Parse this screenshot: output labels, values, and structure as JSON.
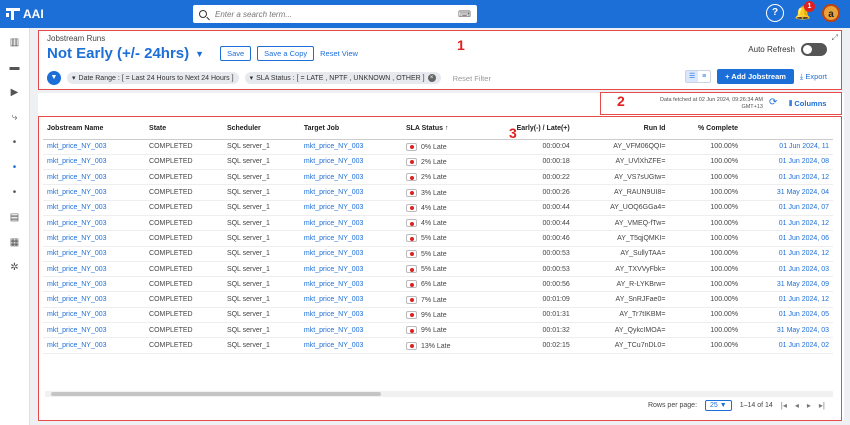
{
  "app": {
    "logo_text": "AAI"
  },
  "search": {
    "placeholder": "Enter a search term...",
    "shortcut_icon": "keyboard-icon"
  },
  "topbar": {
    "help_label": "?",
    "notification_count": "1",
    "avatar_initial": "a"
  },
  "sidebar": {
    "items": [
      {
        "icon": "dashboard-icon",
        "glyph": "▥"
      },
      {
        "icon": "divider-icon",
        "glyph": "▬"
      },
      {
        "icon": "play-icon",
        "glyph": "▶"
      },
      {
        "icon": "workflow-icon",
        "glyph": "⤷"
      },
      {
        "icon": "dot-icon",
        "glyph": "•"
      },
      {
        "icon": "dot-active-icon",
        "glyph": "•"
      },
      {
        "icon": "dot-icon",
        "glyph": "•"
      },
      {
        "icon": "briefcase-icon",
        "glyph": "▤"
      },
      {
        "icon": "report-icon",
        "glyph": "▦"
      },
      {
        "icon": "settings-icon",
        "glyph": "✲"
      }
    ]
  },
  "header": {
    "breadcrumb": "Jobstream Runs",
    "title": "Not Early (+/- 24hrs)",
    "save_label": "Save",
    "save_copy_label": "Save a Copy",
    "reset_view_label": "Reset View",
    "auto_refresh_label": "Auto Refresh",
    "annotation": "1"
  },
  "filters": {
    "chips": [
      "Date Range : [ = Last 24 Hours to Next 24 Hours ]",
      "SLA Status : [ = LATE , NPTF , UNKNOWN , OTHER ]"
    ],
    "reset_label": "Reset Filter"
  },
  "actions": {
    "add_label": "+ Add Jobstream",
    "export_label": "Export"
  },
  "fetch": {
    "line1": "Data fetched at 02 Jun 2024, 09:26:34 AM",
    "line2": "GMT+13",
    "columns_label": "Columns",
    "annotation": "2"
  },
  "table": {
    "annotation": "3",
    "columns": [
      "Jobstream Name",
      "State",
      "Scheduler",
      "Target Job",
      "SLA Status ↑",
      "Early(-) / Late(+)",
      "Run Id",
      "% Complete",
      ""
    ],
    "rows": [
      [
        "mkt_price_NY_003",
        "COMPLETED",
        "SQL server_1",
        "mkt_price_NY_003",
        "0% Late",
        "00:00:04",
        "AY_VFM06QQI=",
        "100.00%",
        "01 Jun 2024, 11"
      ],
      [
        "mkt_price_NY_003",
        "COMPLETED",
        "SQL server_1",
        "mkt_price_NY_003",
        "2% Late",
        "00:00:18",
        "AY_UVlXhZFE=",
        "100.00%",
        "01 Jun 2024, 08"
      ],
      [
        "mkt_price_NY_003",
        "COMPLETED",
        "SQL server_1",
        "mkt_price_NY_003",
        "2% Late",
        "00:00:22",
        "AY_VS7sUGtw=",
        "100.00%",
        "01 Jun 2024, 12"
      ],
      [
        "mkt_price_NY_003",
        "COMPLETED",
        "SQL server_1",
        "mkt_price_NY_003",
        "3% Late",
        "00:00:26",
        "AY_RAUN9UI8=",
        "100.00%",
        "31 May 2024, 04"
      ],
      [
        "mkt_price_NY_003",
        "COMPLETED",
        "SQL server_1",
        "mkt_price_NY_003",
        "4% Late",
        "00:00:44",
        "AY_UOQ6GGa4=",
        "100.00%",
        "01 Jun 2024, 07"
      ],
      [
        "mkt_price_NY_003",
        "COMPLETED",
        "SQL server_1",
        "mkt_price_NY_003",
        "4% Late",
        "00:00:44",
        "AY_VMEQ-fTw=",
        "100.00%",
        "01 Jun 2024, 12"
      ],
      [
        "mkt_price_NY_003",
        "COMPLETED",
        "SQL server_1",
        "mkt_price_NY_003",
        "5% Late",
        "00:00:46",
        "AY_T5qjQMKI=",
        "100.00%",
        "01 Jun 2024, 06"
      ],
      [
        "mkt_price_NY_003",
        "COMPLETED",
        "SQL server_1",
        "mkt_price_NY_003",
        "5% Late",
        "00:00:53",
        "AY_SullyTAA=",
        "100.00%",
        "01 Jun 2024, 12"
      ],
      [
        "mkt_price_NY_003",
        "COMPLETED",
        "SQL server_1",
        "mkt_price_NY_003",
        "5% Late",
        "00:00:53",
        "AY_TXVVyFbk=",
        "100.00%",
        "01 Jun 2024, 03"
      ],
      [
        "mkt_price_NY_003",
        "COMPLETED",
        "SQL server_1",
        "mkt_price_NY_003",
        "6% Late",
        "00:00:56",
        "AY_R-LYKBrw=",
        "100.00%",
        "31 May 2024, 09"
      ],
      [
        "mkt_price_NY_003",
        "COMPLETED",
        "SQL server_1",
        "mkt_price_NY_003",
        "7% Late",
        "00:01:09",
        "AY_SnRJFae0=",
        "100.00%",
        "01 Jun 2024, 12"
      ],
      [
        "mkt_price_NY_003",
        "COMPLETED",
        "SQL server_1",
        "mkt_price_NY_003",
        "9% Late",
        "00:01:31",
        "AY_Tr7tIKBM=",
        "100.00%",
        "01 Jun 2024, 05"
      ],
      [
        "mkt_price_NY_003",
        "COMPLETED",
        "SQL server_1",
        "mkt_price_NY_003",
        "9% Late",
        "00:01:32",
        "AY_QykcIMOA=",
        "100.00%",
        "31 May 2024, 03"
      ],
      [
        "mkt_price_NY_003",
        "COMPLETED",
        "SQL server_1",
        "mkt_price_NY_003",
        "13% Late",
        "00:02:15",
        "AY_TCu7nDL0=",
        "100.00%",
        "01 Jun 2024, 02"
      ]
    ]
  },
  "pager": {
    "rows_per_page_label": "Rows per page:",
    "rows_per_page_value": "25",
    "range_label": "1–14 of 14"
  },
  "colors": {
    "brand": "#1d6fd8",
    "annotation": "#e84a4a",
    "late_dot": "#e02020"
  }
}
